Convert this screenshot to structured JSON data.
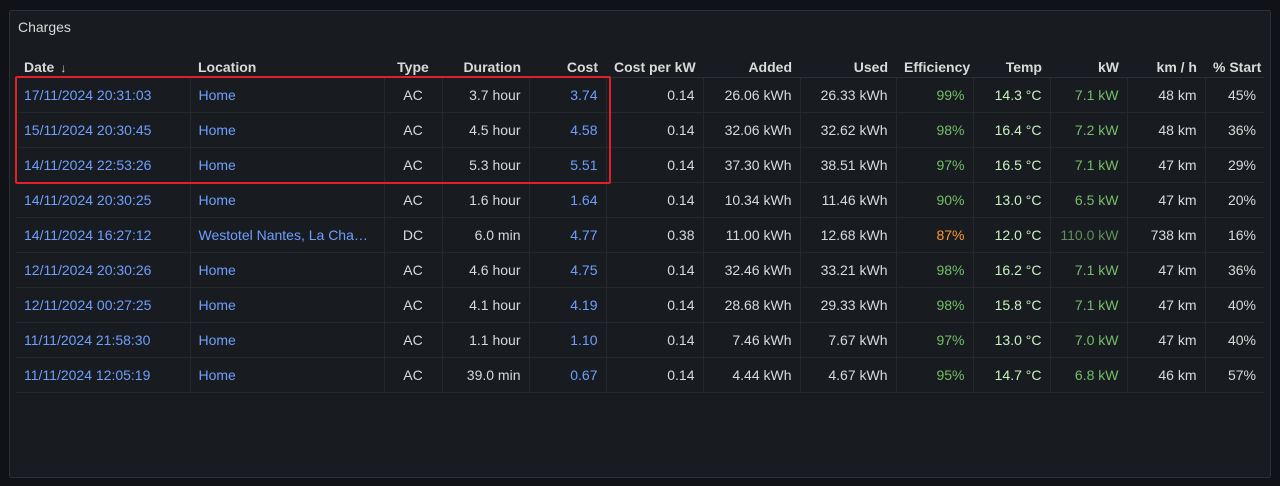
{
  "panel": {
    "title": "Charges"
  },
  "columns": [
    {
      "key": "date",
      "label": "Date",
      "align": "l",
      "sorted": true
    },
    {
      "key": "location",
      "label": "Location",
      "align": "l"
    },
    {
      "key": "type",
      "label": "Type",
      "align": "c"
    },
    {
      "key": "duration",
      "label": "Duration",
      "align": "r"
    },
    {
      "key": "cost",
      "label": "Cost",
      "align": "r"
    },
    {
      "key": "cost_per_kw",
      "label": "Cost per kW",
      "align": "r"
    },
    {
      "key": "added",
      "label": "Added",
      "align": "r"
    },
    {
      "key": "used",
      "label": "Used",
      "align": "r"
    },
    {
      "key": "efficiency",
      "label": "Efficiency",
      "align": "r"
    },
    {
      "key": "temp",
      "label": "Temp",
      "align": "r"
    },
    {
      "key": "kw",
      "label": "kW",
      "align": "r"
    },
    {
      "key": "kmh",
      "label": "km / h",
      "align": "r"
    },
    {
      "key": "start",
      "label": "% Start",
      "align": "r"
    }
  ],
  "rows": [
    {
      "date": "17/11/2024 20:31:03",
      "location": "Home",
      "type": "AC",
      "duration": "3.7 hour",
      "cost": "3.74",
      "cost_per_kw": "0.14",
      "added": "26.06 kWh",
      "used": "26.33 kWh",
      "efficiency": "99%",
      "temp": "14.3 °C",
      "kw": "7.1 kW",
      "kmh": "48 km",
      "start": "45%"
    },
    {
      "date": "15/11/2024 20:30:45",
      "location": "Home",
      "type": "AC",
      "duration": "4.5 hour",
      "cost": "4.58",
      "cost_per_kw": "0.14",
      "added": "32.06 kWh",
      "used": "32.62 kWh",
      "efficiency": "98%",
      "temp": "16.4 °C",
      "kw": "7.2 kW",
      "kmh": "48 km",
      "start": "36%"
    },
    {
      "date": "14/11/2024 22:53:26",
      "location": "Home",
      "type": "AC",
      "duration": "5.3 hour",
      "cost": "5.51",
      "cost_per_kw": "0.14",
      "added": "37.30 kWh",
      "used": "38.51 kWh",
      "efficiency": "97%",
      "temp": "16.5 °C",
      "kw": "7.1 kW",
      "kmh": "47 km",
      "start": "29%"
    },
    {
      "date": "14/11/2024 20:30:25",
      "location": "Home",
      "type": "AC",
      "duration": "1.6 hour",
      "cost": "1.64",
      "cost_per_kw": "0.14",
      "added": "10.34 kWh",
      "used": "11.46 kWh",
      "efficiency": "90%",
      "temp": "13.0 °C",
      "kw": "6.5 kW",
      "kmh": "47 km",
      "start": "20%"
    },
    {
      "date": "14/11/2024 16:27:12",
      "location": "Westotel Nantes, La Cha…",
      "type": "DC",
      "duration": "6.0 min",
      "cost": "4.77",
      "cost_per_kw": "0.38",
      "added": "11.00 kWh",
      "used": "12.68 kWh",
      "efficiency": "87%",
      "temp": "12.0 °C",
      "kw": "110.0 kW",
      "kmh": "738 km",
      "start": "16%"
    },
    {
      "date": "12/11/2024 20:30:26",
      "location": "Home",
      "type": "AC",
      "duration": "4.6 hour",
      "cost": "4.75",
      "cost_per_kw": "0.14",
      "added": "32.46 kWh",
      "used": "33.21 kWh",
      "efficiency": "98%",
      "temp": "16.2 °C",
      "kw": "7.1 kW",
      "kmh": "47 km",
      "start": "36%"
    },
    {
      "date": "12/11/2024 00:27:25",
      "location": "Home",
      "type": "AC",
      "duration": "4.1 hour",
      "cost": "4.19",
      "cost_per_kw": "0.14",
      "added": "28.68 kWh",
      "used": "29.33 kWh",
      "efficiency": "98%",
      "temp": "15.8 °C",
      "kw": "7.1 kW",
      "kmh": "47 km",
      "start": "40%"
    },
    {
      "date": "11/11/2024 21:58:30",
      "location": "Home",
      "type": "AC",
      "duration": "1.1 hour",
      "cost": "1.10",
      "cost_per_kw": "0.14",
      "added": "7.46 kWh",
      "used": "7.67 kWh",
      "efficiency": "97%",
      "temp": "13.0 °C",
      "kw": "7.0 kW",
      "kmh": "47 km",
      "start": "40%"
    },
    {
      "date": "11/11/2024 12:05:19",
      "location": "Home",
      "type": "AC",
      "duration": "39.0 min",
      "cost": "0.67",
      "cost_per_kw": "0.14",
      "added": "4.44 kWh",
      "used": "4.67 kWh",
      "efficiency": "95%",
      "temp": "14.7 °C",
      "kw": "6.8 kW",
      "kmh": "46 km",
      "start": "57%"
    }
  ],
  "colors": {
    "link": "#6e9fff",
    "efficiency_high": "#73bf69",
    "efficiency_low": "#ff9830",
    "temp": "#c8f2c2",
    "kw": "#73bf69",
    "kw_dc": "#5f8f58",
    "highlight_border": "#e0212b"
  },
  "icons": {
    "sort": "arrow-down-icon"
  }
}
